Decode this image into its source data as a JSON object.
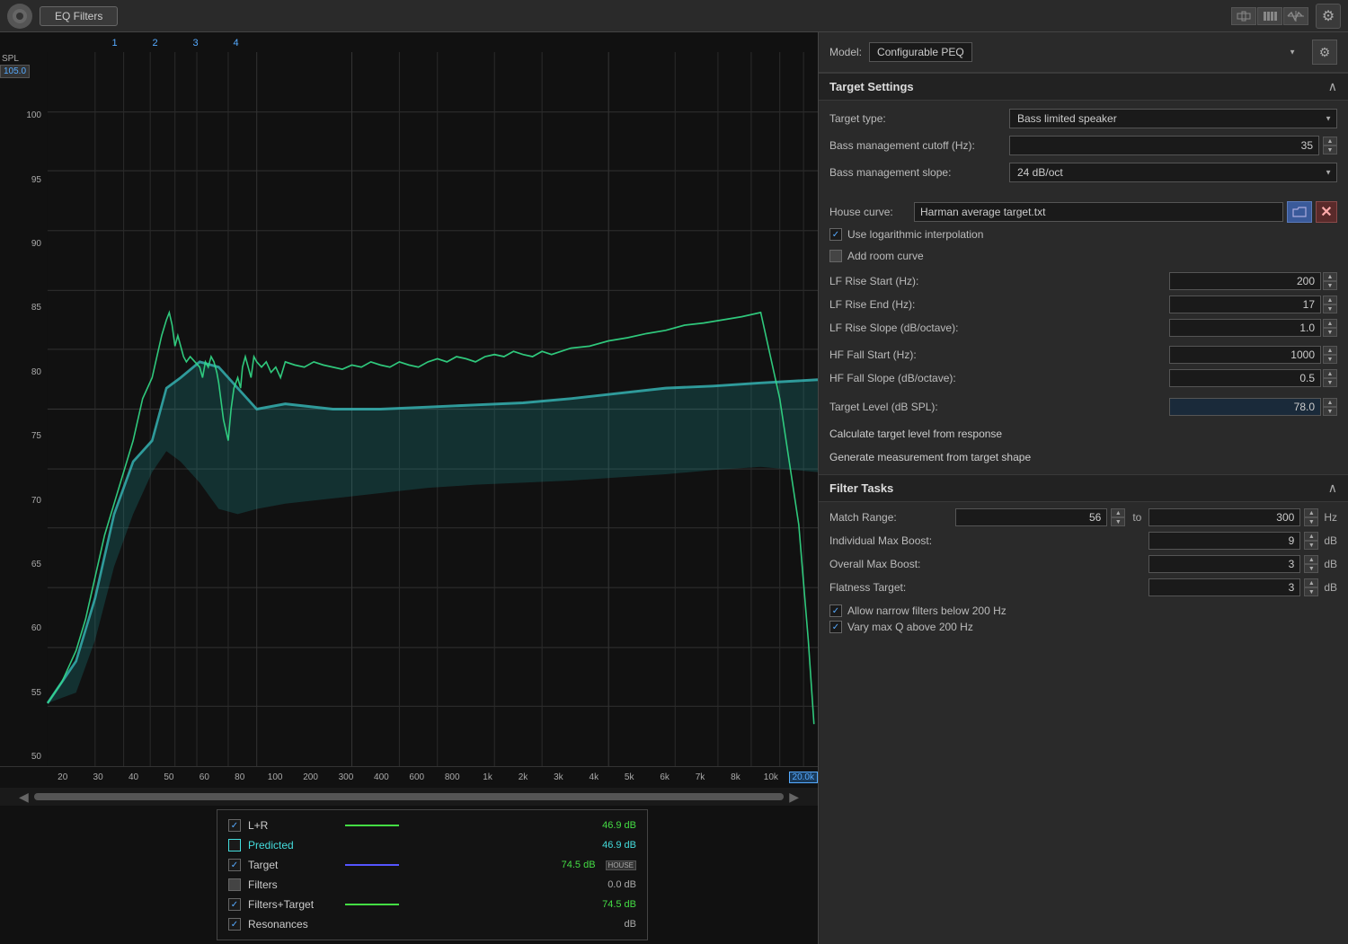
{
  "topbar": {
    "eq_filters_label": "EQ Filters",
    "gear_icon": "⚙"
  },
  "filter_numbers": [
    "1",
    "2",
    "3",
    "4"
  ],
  "yaxis_labels": [
    "105.0",
    "100",
    "95",
    "90",
    "85",
    "80",
    "75",
    "70",
    "65",
    "60",
    "55",
    "50"
  ],
  "xaxis_labels": [
    "20",
    "30",
    "40",
    "50",
    "60",
    "80",
    "100",
    "200",
    "300",
    "400",
    "600",
    "800",
    "1k",
    "2k",
    "3k",
    "4k",
    "5k",
    "6k",
    "7k",
    "8k",
    "10k"
  ],
  "xaxis_highlight": "20.0k",
  "spl_label": "SPL",
  "spl_value": "105.0",
  "legend": {
    "items": [
      {
        "checked": true,
        "label": "L+R",
        "line_color": "#4d4",
        "value": "46.9 dB",
        "has_line": true
      },
      {
        "checked": false,
        "label": "Predicted",
        "line_color": "#4dd",
        "value": "46.9 dB",
        "has_line": false,
        "outline": true
      },
      {
        "checked": true,
        "label": "Target",
        "line_color": "#55f",
        "value": "74.5 dB",
        "has_line": true,
        "badge": "HOUSE"
      },
      {
        "checked": false,
        "label": "Filters",
        "line_color": "#888",
        "value": "0.0 dB",
        "has_line": false,
        "gray": true
      },
      {
        "checked": true,
        "label": "Filters+Target",
        "line_color": "#4d4",
        "value": "74.5 dB",
        "has_line": true
      },
      {
        "checked": true,
        "label": "Resonances",
        "line_color": "#888",
        "value": "dB",
        "has_line": false
      }
    ]
  },
  "model": {
    "label": "Model:",
    "value": "Configurable PEQ"
  },
  "target_settings": {
    "title": "Target Settings",
    "target_type_label": "Target type:",
    "target_type_value": "Bass limited speaker",
    "bass_cutoff_label": "Bass management cutoff (Hz):",
    "bass_cutoff_value": "35",
    "bass_slope_label": "Bass management slope:",
    "bass_slope_value": "24 dB/oct",
    "house_curve_label": "House curve:",
    "house_curve_value": "Harman average target.txt",
    "log_interp_label": "Use logarithmic interpolation",
    "add_room_label": "Add room curve",
    "lf_rise_start_label": "LF Rise Start (Hz):",
    "lf_rise_start_value": "200",
    "lf_rise_end_label": "LF Rise End (Hz):",
    "lf_rise_end_value": "17",
    "lf_rise_slope_label": "LF Rise Slope (dB/octave):",
    "lf_rise_slope_value": "1.0",
    "hf_fall_start_label": "HF Fall Start (Hz):",
    "hf_fall_start_value": "1000",
    "hf_fall_slope_label": "HF Fall Slope (dB/octave):",
    "hf_fall_slope_value": "0.5",
    "target_level_label": "Target Level (dB SPL):",
    "target_level_value": "78.0",
    "calc_target_label": "Calculate target level from response",
    "gen_measurement_label": "Generate measurement from target shape"
  },
  "filter_tasks": {
    "title": "Filter Tasks",
    "match_range_label": "Match Range:",
    "match_range_from": "56",
    "match_range_to": "300",
    "match_range_unit": "Hz",
    "max_boost_individual_label": "Individual Max Boost:",
    "max_boost_individual_value": "9",
    "max_boost_individual_unit": "dB",
    "overall_max_boost_label": "Overall Max Boost:",
    "overall_max_boost_value": "3",
    "overall_max_boost_unit": "dB",
    "flatness_target_label": "Flatness Target:",
    "flatness_target_value": "3",
    "flatness_target_unit": "dB",
    "narrow_filters_label": "Allow narrow filters below 200 Hz",
    "vary_q_label": "Vary max Q above 200 Hz"
  }
}
